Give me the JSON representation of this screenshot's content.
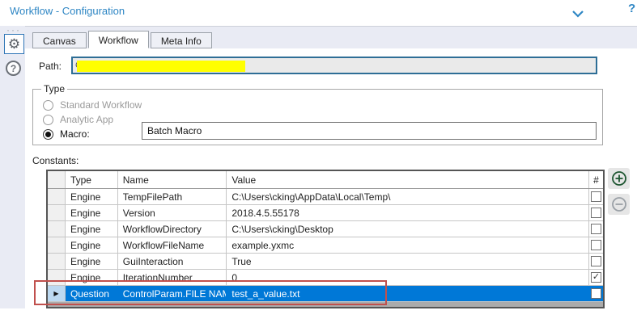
{
  "header": {
    "title": "Workflow - Configuration",
    "collapse_icon": "chevron-down",
    "help_icon": "question-mark-partial"
  },
  "sidebar": {
    "drag_dots": "···",
    "settings_icon": "gear",
    "help_icon": "question-mark-circle",
    "help_glyph": "?"
  },
  "tabs": [
    {
      "label": "Canvas",
      "active": false
    },
    {
      "label": "Workflow",
      "active": true
    },
    {
      "label": "Meta Info",
      "active": false
    }
  ],
  "path": {
    "label": "Path:",
    "visible_prefix": "C",
    "redacted": true
  },
  "type_group": {
    "legend": "Type",
    "options": [
      {
        "label": "Standard Workflow",
        "selected": false,
        "enabled": false
      },
      {
        "label": "Analytic App",
        "selected": false,
        "enabled": false
      },
      {
        "label": "Macro:",
        "selected": true,
        "enabled": true
      }
    ],
    "macro_type_value": "Batch Macro"
  },
  "constants": {
    "label": "Constants:",
    "columns": {
      "gutter": "",
      "type": "Type",
      "name": "Name",
      "value": "Value",
      "hash": "#"
    },
    "rows": [
      {
        "type": "Engine",
        "name": "TempFilePath",
        "value": "C:\\Users\\cking\\AppData\\Local\\Temp\\",
        "checked": false,
        "selected": false
      },
      {
        "type": "Engine",
        "name": "Version",
        "value": "2018.4.5.55178",
        "checked": false,
        "selected": false
      },
      {
        "type": "Engine",
        "name": "WorkflowDirectory",
        "value": "C:\\Users\\cking\\Desktop",
        "checked": false,
        "selected": false
      },
      {
        "type": "Engine",
        "name": "WorkflowFileName",
        "value": "example.yxmc",
        "checked": false,
        "selected": false
      },
      {
        "type": "Engine",
        "name": "GuiInteraction",
        "value": "True",
        "checked": false,
        "selected": false
      },
      {
        "type": "Engine",
        "name": "IterationNumber",
        "value": "0",
        "checked": true,
        "selected": false
      },
      {
        "type": "Question",
        "name": "ControlParam.FILE NAME",
        "value": "test_a_value.txt",
        "checked": false,
        "selected": true
      }
    ],
    "add_icon": "plus-circle",
    "remove_icon": "minus-circle"
  },
  "annotation": {
    "type": "red-highlight-box"
  },
  "colors": {
    "accent_blue": "#2e86c4",
    "selection_blue": "#0078d7",
    "annotation_red": "#c0504d",
    "redaction_yellow": "#ffff00",
    "band_bg": "#e9ebf4",
    "plus_green": "#1e5631"
  }
}
